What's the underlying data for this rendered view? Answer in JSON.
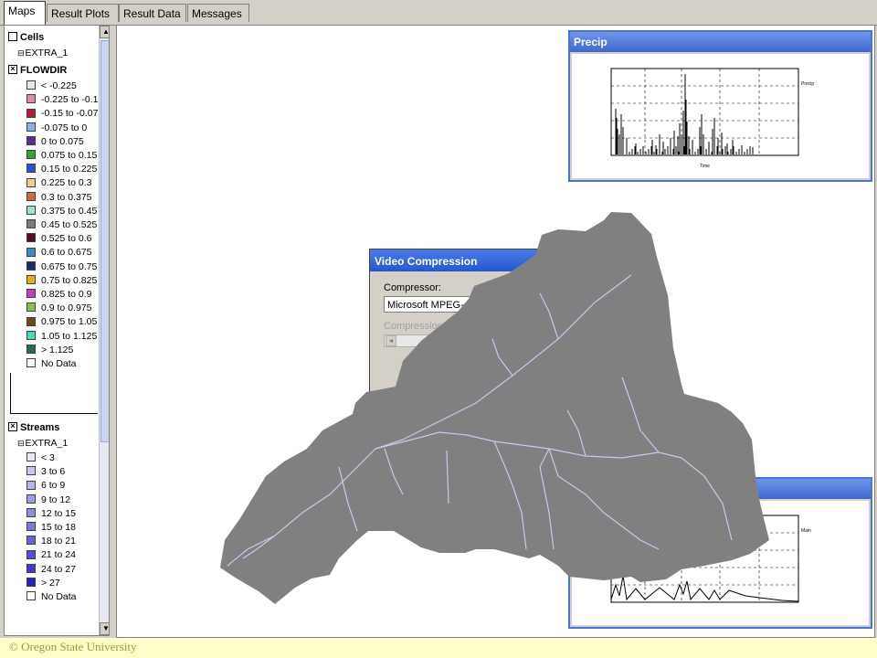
{
  "tabs": [
    "Maps",
    "Result Plots",
    "Result Data",
    "Messages"
  ],
  "legend": {
    "cells_label": "Cells",
    "extra_label": "EXTRA_1",
    "flowdir_label": "FLOWDIR",
    "flowdir_items": [
      {
        "label": "< -0.225",
        "color": "#e6e6e6"
      },
      {
        "label": "-0.225 to -0.1",
        "color": "#d88ea0"
      },
      {
        "label": "-0.15 to -0.07",
        "color": "#b0203a"
      },
      {
        "label": "-0.075 to 0",
        "color": "#8ab0e0"
      },
      {
        "label": "0 to 0.075",
        "color": "#5a2a8a"
      },
      {
        "label": "0.075 to 0.15",
        "color": "#3aa03a"
      },
      {
        "label": "0.15 to 0.225",
        "color": "#2a4ad8"
      },
      {
        "label": "0.225 to 0.3",
        "color": "#f0d090"
      },
      {
        "label": "0.3 to 0.375",
        "color": "#d06a3a"
      },
      {
        "label": "0.375 to 0.45",
        "color": "#a0e0d0"
      },
      {
        "label": "0.45 to 0.525",
        "color": "#7a7a7a"
      },
      {
        "label": "0.525 to 0.6",
        "color": "#5a0a1a"
      },
      {
        "label": "0.6 to 0.675",
        "color": "#3a8aba"
      },
      {
        "label": "0.675 to 0.75",
        "color": "#1a2a6a"
      },
      {
        "label": "0.75 to 0.825",
        "color": "#e0b020"
      },
      {
        "label": "0.825 to 0.9",
        "color": "#c040c0"
      },
      {
        "label": "0.9 to 0.975",
        "color": "#8ac050"
      },
      {
        "label": "0.975 to 1.05",
        "color": "#6a4a1a"
      },
      {
        "label": "1.05 to 1.125",
        "color": "#40e0b0"
      },
      {
        "label": "> 1.125",
        "color": "#2a6a4a"
      },
      {
        "label": "No Data",
        "color": "#ffffff"
      }
    ],
    "streams_label": "Streams",
    "streams_items": [
      {
        "label": "< 3",
        "color": "#e8e8f8"
      },
      {
        "label": "3 to 6",
        "color": "#c8c8f0"
      },
      {
        "label": "6 to 9",
        "color": "#b4b4ec"
      },
      {
        "label": "9 to 12",
        "color": "#a0a0e8"
      },
      {
        "label": "12 to 15",
        "color": "#8c8ce4"
      },
      {
        "label": "15 to 18",
        "color": "#7878e0"
      },
      {
        "label": "18 to 21",
        "color": "#6464dc"
      },
      {
        "label": "21 to 24",
        "color": "#5050d8"
      },
      {
        "label": "24 to 27",
        "color": "#3c3cd4"
      },
      {
        "label": "> 27",
        "color": "#2020d0"
      },
      {
        "label": "No Data",
        "color": "#ffffff"
      }
    ]
  },
  "precip_window": {
    "title": "Precip",
    "legend": "Precip",
    "x_label": "Time"
  },
  "bottom_window": {
    "legend": "Main"
  },
  "dialog": {
    "title": "Video Compression",
    "compressor_label": "Compressor:",
    "compressor_value": "Microsoft MPEG-4 Vid",
    "quality_label": "Compression Qu"
  },
  "watershed_color": "#808080",
  "stream_color": "#c8c8f0",
  "footer": "© Oregon State University"
}
